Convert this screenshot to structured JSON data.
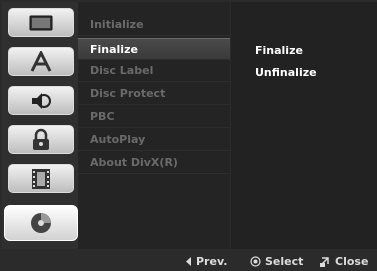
{
  "sidebar": {
    "icons": [
      "display-icon",
      "language-icon",
      "audio-icon",
      "lock-icon",
      "film-icon",
      "disc-icon"
    ],
    "active_index": 5
  },
  "menu": {
    "items": [
      "Initialize",
      "Finalize",
      "Disc Label",
      "Disc Protect",
      "PBC",
      "AutoPlay",
      "About DivX(R)"
    ],
    "selected_index": 1
  },
  "options": {
    "items": [
      "Finalize",
      "Unfinalize"
    ]
  },
  "footer": {
    "prev_label": "Prev.",
    "select_label": "Select",
    "close_label": "Close"
  },
  "colors": {
    "highlight_text": "#ffffff",
    "disabled_text": "#6a6a6a",
    "panel_bg": "#242424"
  }
}
